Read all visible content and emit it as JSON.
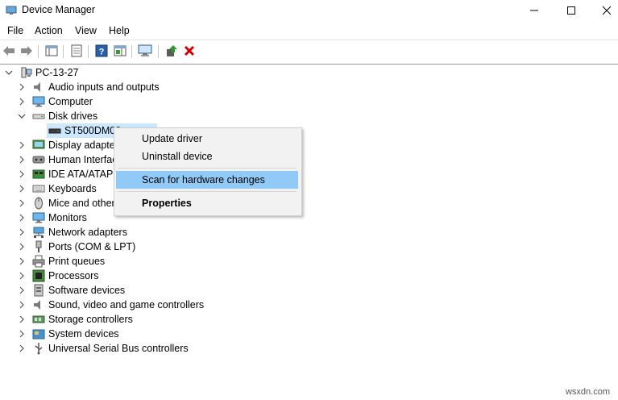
{
  "window": {
    "title": "Device Manager"
  },
  "menu": [
    "File",
    "Action",
    "View",
    "Help"
  ],
  "tree": {
    "root": "PC-13-27",
    "categories": [
      {
        "label": "Audio inputs and outputs",
        "icon": "speaker-icon"
      },
      {
        "label": "Computer",
        "icon": "monitor-icon"
      },
      {
        "label": "Disk drives",
        "icon": "disk-drive-icon",
        "expanded": true,
        "children": [
          "ST500DM00"
        ]
      },
      {
        "label": "Display adapter",
        "icon": "display-adapter-icon"
      },
      {
        "label": "Human Interfac",
        "icon": "hid-icon"
      },
      {
        "label": "IDE ATA/ATAPI",
        "icon": "ide-controller-icon"
      },
      {
        "label": "Keyboards",
        "icon": "keyboard-icon"
      },
      {
        "label": "Mice and other",
        "icon": "mouse-icon"
      },
      {
        "label": "Monitors",
        "icon": "monitor-icon"
      },
      {
        "label": "Network adapters",
        "icon": "network-icon"
      },
      {
        "label": "Ports (COM & LPT)",
        "icon": "port-icon"
      },
      {
        "label": "Print queues",
        "icon": "printer-icon"
      },
      {
        "label": "Processors",
        "icon": "processor-icon"
      },
      {
        "label": "Software devices",
        "icon": "software-icon"
      },
      {
        "label": "Sound, video and game controllers",
        "icon": "speaker-icon"
      },
      {
        "label": "Storage controllers",
        "icon": "storage-icon"
      },
      {
        "label": "System devices",
        "icon": "system-folder-icon"
      },
      {
        "label": "Universal Serial Bus controllers",
        "icon": "usb-icon"
      }
    ]
  },
  "context_menu": {
    "items": [
      "Update driver",
      "Uninstall device",
      "Scan for hardware changes",
      "Properties"
    ],
    "highlighted": "Scan for hardware changes"
  },
  "watermark": "wsxdn.com",
  "colors": {
    "selection": "#cce8ff",
    "menu_highlight": "#91c9f7",
    "delete_red": "#d00000"
  }
}
